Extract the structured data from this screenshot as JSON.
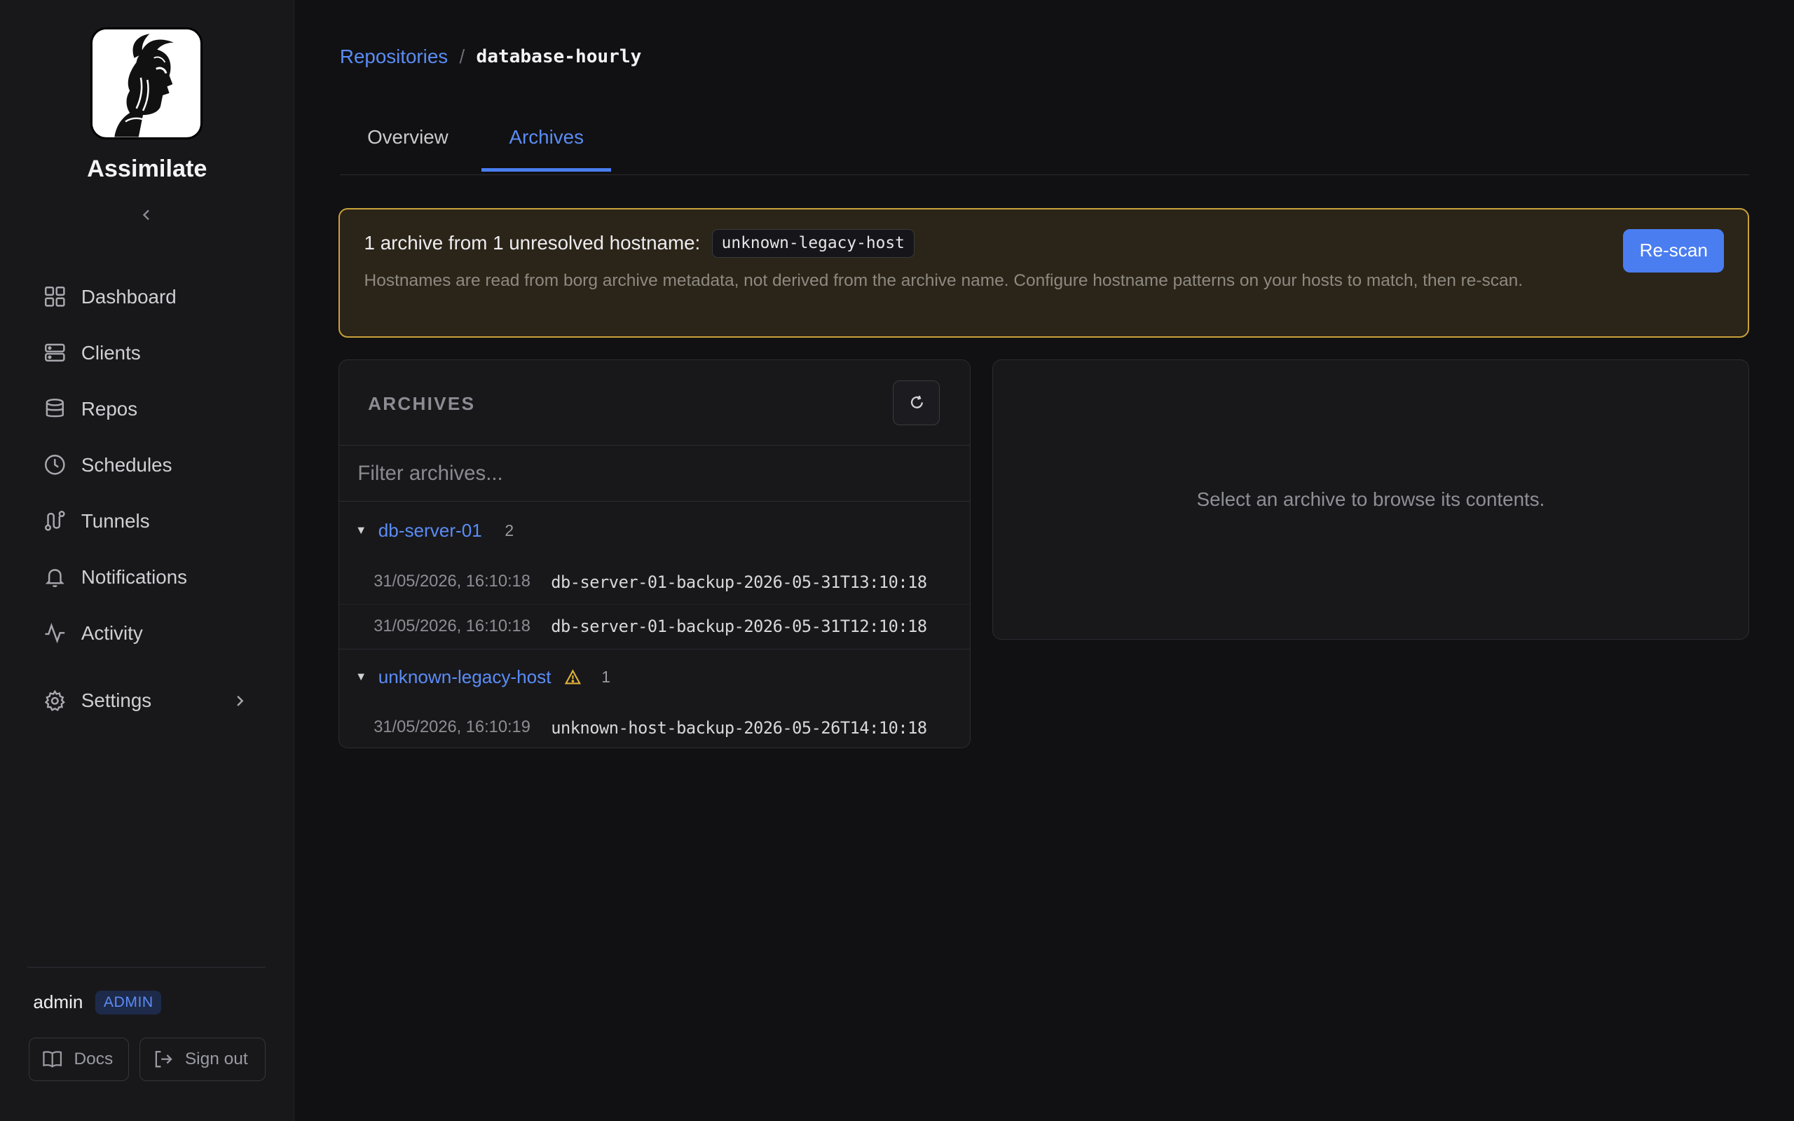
{
  "app": {
    "name": "Assimilate"
  },
  "sidebar": {
    "items": [
      {
        "label": "Dashboard",
        "icon": "grid-icon"
      },
      {
        "label": "Clients",
        "icon": "server-icon"
      },
      {
        "label": "Repos",
        "icon": "database-icon"
      },
      {
        "label": "Schedules",
        "icon": "clock-icon"
      },
      {
        "label": "Tunnels",
        "icon": "route-icon"
      },
      {
        "label": "Notifications",
        "icon": "bell-icon"
      },
      {
        "label": "Activity",
        "icon": "activity-icon"
      },
      {
        "label": "Settings",
        "icon": "gear-icon"
      }
    ],
    "user": {
      "name": "admin",
      "role": "ADMIN"
    },
    "docs_label": "Docs",
    "signout_label": "Sign out"
  },
  "breadcrumb": {
    "root": "Repositories",
    "separator": "/",
    "current": "database-hourly"
  },
  "tabs": [
    {
      "label": "Overview"
    },
    {
      "label": "Archives",
      "active": true
    }
  ],
  "warning": {
    "title": "1 archive from 1 unresolved hostname:",
    "hostname": "unknown-legacy-host",
    "body": "Hostnames are read from borg archive metadata, not derived from the archive name. Configure hostname patterns on your hosts to match, then re-scan.",
    "button": "Re-scan",
    "accent": "#c9a23a"
  },
  "archives": {
    "title": "ARCHIVES",
    "filter_placeholder": "Filter archives...",
    "groups": [
      {
        "host": "db-server-01",
        "count": "2",
        "items": [
          {
            "date": "31/05/2026, 16:10:18",
            "name": "db-server-01-backup-2026-05-31T13:10:18"
          },
          {
            "date": "31/05/2026, 16:10:18",
            "name": "db-server-01-backup-2026-05-31T12:10:18"
          }
        ]
      },
      {
        "host": "unknown-legacy-host",
        "count": "1",
        "warning": true,
        "items": [
          {
            "date": "31/05/2026, 16:10:19",
            "name": "unknown-host-backup-2026-05-26T14:10:18"
          }
        ]
      }
    ]
  },
  "browser": {
    "empty_message": "Select an archive to browse its contents."
  },
  "colors": {
    "accent": "#4a7df0",
    "link": "#5b8cf5",
    "background": "#111113",
    "warning": "#e0b23a"
  }
}
